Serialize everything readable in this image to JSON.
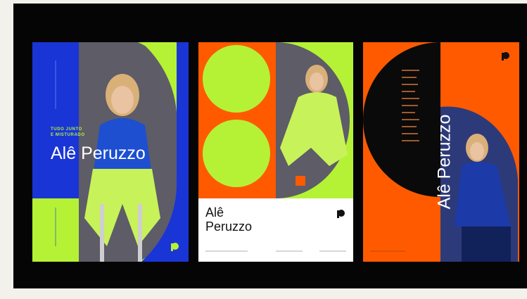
{
  "colors": {
    "blue": "#1a35d6",
    "lime": "#b5f235",
    "orange": "#ff5a00",
    "black": "#050505",
    "white": "#ffffff",
    "gray_bg": "#5b5a66"
  },
  "poster_left": {
    "tagline_line1": "TUDO JUNTO",
    "tagline_line2": "E MISTURADO",
    "name": "Alê Peruzzo",
    "logo_icon": "p-logo-icon"
  },
  "poster_middle": {
    "name_line1": "Alê",
    "name_line2": "Peruzzo",
    "logo_icon": "p-logo-icon"
  },
  "poster_right": {
    "name": "Alê Peruzzo",
    "logo_icon": "p-logo-icon"
  }
}
